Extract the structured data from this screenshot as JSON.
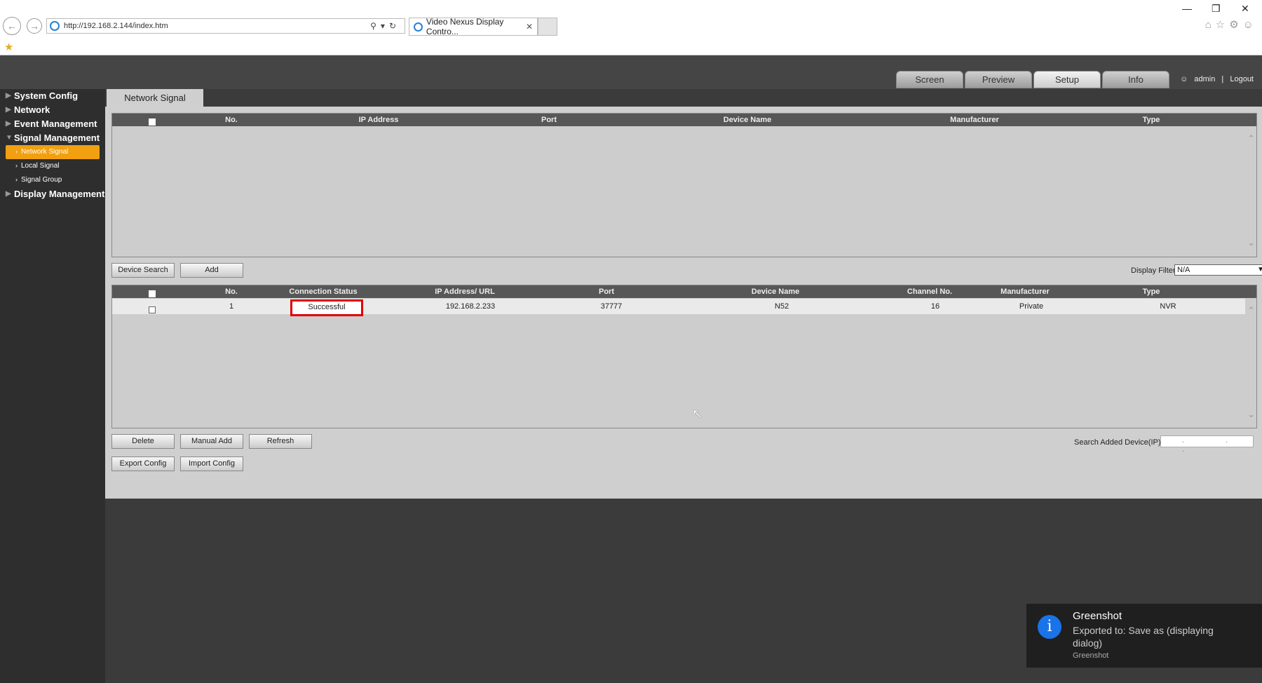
{
  "browser": {
    "url": "http://192.168.2.144/index.htm",
    "tab_title": "Video Nexus Display Contro..."
  },
  "top_tabs": [
    {
      "label": "Screen"
    },
    {
      "label": "Preview"
    },
    {
      "label": "Setup"
    },
    {
      "label": "Info"
    }
  ],
  "user": {
    "name": "admin",
    "separator": "|",
    "logout": "Logout"
  },
  "sidebar": {
    "items": [
      {
        "label": "System Config"
      },
      {
        "label": "Network"
      },
      {
        "label": "Event Management"
      },
      {
        "label": "Signal Management"
      },
      {
        "label": "Display Management"
      }
    ],
    "sub_items": [
      {
        "label": "Network Signal"
      },
      {
        "label": "Local Signal"
      },
      {
        "label": "Signal Group"
      }
    ]
  },
  "page_tab": "Network Signal",
  "search_table": {
    "headers": [
      "No.",
      "IP Address",
      "Port",
      "Device Name",
      "Manufacturer",
      "Type"
    ]
  },
  "buttons": {
    "device_search": "Device Search",
    "add": "Add",
    "delete": "Delete",
    "manual_add": "Manual Add",
    "refresh": "Refresh",
    "export_config": "Export Config",
    "import_config": "Import Config"
  },
  "display_filter": {
    "label": "Display Filter",
    "value": "N/A"
  },
  "added_table": {
    "headers": [
      "No.",
      "Connection Status",
      "IP Address/ URL",
      "Port",
      "Device Name",
      "Channel No.",
      "Manufacturer",
      "Type"
    ],
    "rows": [
      {
        "no": "1",
        "status": "Successful",
        "ip": "192.168.2.233",
        "port": "37777",
        "device_name": "N52",
        "channel": "16",
        "manufacturer": "Private",
        "type": "NVR"
      }
    ]
  },
  "search_added": {
    "label": "Search Added Device(IP)",
    "value": ". . ."
  },
  "toast": {
    "title": "Greenshot",
    "message": "Exported to: Save as (displaying dialog)",
    "source": "Greenshot",
    "icon": "info-icon"
  },
  "colors": {
    "active_nav": "#f0a010",
    "highlight_border": "#e00000",
    "toast_icon": "#1a73e8"
  }
}
